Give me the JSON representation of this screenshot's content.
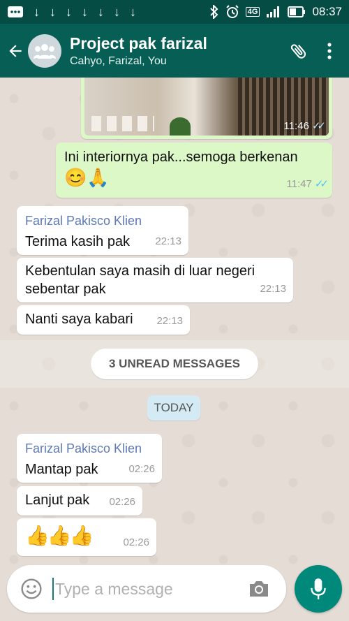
{
  "status_bar": {
    "download_icons": [
      "↓",
      "↓",
      "↓",
      "↓",
      "↓",
      "↓",
      "↓"
    ],
    "network_type": "4G",
    "time": "08:37"
  },
  "header": {
    "title": "Project pak farizal",
    "subtitle": "Cahyo, Farizal, You"
  },
  "messages": {
    "image": {
      "time": "11:46",
      "ticks": "✓✓"
    },
    "m1": {
      "text_line": "Ini interiornya pak...semoga berkenan",
      "emoji": "😊🙏",
      "time": "11:47",
      "ticks": "✓✓"
    },
    "m2": {
      "sender": "Farizal Pakisco Klien",
      "text": "Terima kasih pak",
      "time": "22:13"
    },
    "m3": {
      "line1": "Kebentulan saya masih di luar negeri",
      "line2": "sebentar pak",
      "time": "22:13"
    },
    "m4": {
      "text": "Nanti saya kabari",
      "time": "22:13"
    },
    "unread": "3 UNREAD MESSAGES",
    "today": "TODAY",
    "m5": {
      "sender": "Farizal Pakisco Klien",
      "text": "Mantap pak",
      "time": "02:26"
    },
    "m6": {
      "text": "Lanjut pak",
      "time": "02:26"
    },
    "m7": {
      "emoji": "👍👍👍",
      "time": "02:26"
    }
  },
  "composer": {
    "placeholder": "Type a message"
  },
  "colors": {
    "header": "#075e54",
    "status_bar": "#054d44",
    "outgoing": "#dcf8c6",
    "incoming": "#ffffff",
    "sender_name": "#5e79b5",
    "fab": "#00897b",
    "read_ticks": "#4fc3f7"
  },
  "icons": [
    "download-icon",
    "bluetooth-icon",
    "alarm-icon",
    "signal-icon",
    "battery-icon",
    "back-arrow-icon",
    "group-avatar-icon",
    "attach-icon",
    "more-vert-icon",
    "emoji-icon",
    "camera-icon",
    "mic-icon"
  ]
}
